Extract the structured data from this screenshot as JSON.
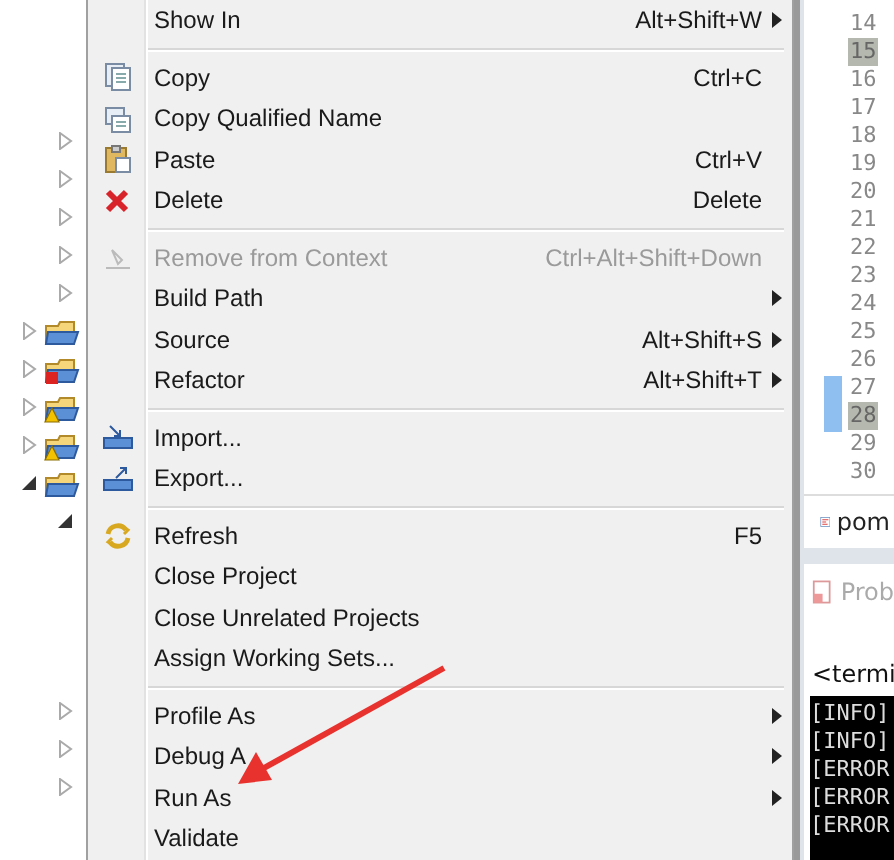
{
  "tree": [
    {
      "kind": "node",
      "expanded": false
    },
    {
      "kind": "node",
      "expanded": false
    },
    {
      "kind": "node",
      "expanded": false
    },
    {
      "kind": "node",
      "expanded": false
    },
    {
      "kind": "node",
      "expanded": false
    },
    {
      "kind": "project",
      "expanded": false
    },
    {
      "kind": "project",
      "expanded": false
    },
    {
      "kind": "project",
      "expanded": false
    },
    {
      "kind": "project",
      "expanded": false
    },
    {
      "kind": "project",
      "expanded": true
    },
    {
      "kind": "node",
      "expanded": true
    },
    {
      "kind": "node",
      "expanded": false
    },
    {
      "kind": "node",
      "expanded": false
    },
    {
      "kind": "node",
      "expanded": false
    }
  ],
  "menu": [
    {
      "kind": "item",
      "label": "Show In",
      "shortcut": "Alt+Shift+W",
      "submenu": true,
      "disabled": false
    },
    {
      "kind": "separator"
    },
    {
      "kind": "item",
      "label": "Copy",
      "shortcut": "Ctrl+C",
      "submenu": false,
      "disabled": false
    },
    {
      "kind": "item",
      "label": "Copy Qualified Name",
      "submenu": false,
      "disabled": false
    },
    {
      "kind": "item",
      "label": "Paste",
      "shortcut": "Ctrl+V",
      "submenu": false,
      "disabled": false
    },
    {
      "kind": "item",
      "label": "Delete",
      "shortcut": "Delete",
      "submenu": false,
      "disabled": false
    },
    {
      "kind": "separator"
    },
    {
      "kind": "item",
      "label": "Remove from Context",
      "shortcut": "Ctrl+Alt+Shift+Down",
      "submenu": false,
      "disabled": true
    },
    {
      "kind": "item",
      "label": "Build Path",
      "submenu": true,
      "disabled": false
    },
    {
      "kind": "item",
      "label": "Source",
      "shortcut": "Alt+Shift+S",
      "submenu": true,
      "disabled": false
    },
    {
      "kind": "item",
      "label": "Refactor",
      "shortcut": "Alt+Shift+T",
      "submenu": true,
      "disabled": false
    },
    {
      "kind": "separator"
    },
    {
      "kind": "item",
      "label": "Import...",
      "submenu": false,
      "disabled": false
    },
    {
      "kind": "item",
      "label": "Export...",
      "submenu": false,
      "disabled": false
    },
    {
      "kind": "separator"
    },
    {
      "kind": "item",
      "label": "Refresh",
      "shortcut": "F5",
      "submenu": false,
      "disabled": false
    },
    {
      "kind": "item",
      "label": "Close Project",
      "submenu": false,
      "disabled": false
    },
    {
      "kind": "item",
      "label": "Close Unrelated Projects",
      "submenu": false,
      "disabled": false
    },
    {
      "kind": "item",
      "label": "Assign Working Sets...",
      "submenu": false,
      "disabled": false
    },
    {
      "kind": "separator"
    },
    {
      "kind": "item",
      "label": "Profile As",
      "submenu": true,
      "disabled": false
    },
    {
      "kind": "item",
      "label": "Debug A",
      "submenu": true,
      "disabled": false
    },
    {
      "kind": "item",
      "label": "Run As",
      "submenu": true,
      "disabled": false
    },
    {
      "kind": "item",
      "label": "Validate",
      "submenu": false,
      "disabled": false
    }
  ],
  "editor": {
    "line_numbers": [
      {
        "text": "14",
        "selected": false
      },
      {
        "text": "15",
        "selected": true
      },
      {
        "text": "16",
        "selected": false
      },
      {
        "text": "17",
        "selected": false
      },
      {
        "text": "18",
        "selected": false
      },
      {
        "text": "19",
        "selected": false
      },
      {
        "text": "20",
        "selected": false
      },
      {
        "text": "21",
        "selected": false
      },
      {
        "text": "22",
        "selected": false
      },
      {
        "text": "23",
        "selected": false
      },
      {
        "text": "24",
        "selected": false
      },
      {
        "text": "25",
        "selected": false
      },
      {
        "text": "26",
        "selected": false
      },
      {
        "text": "27",
        "selected": false
      },
      {
        "text": "28",
        "selected": true
      },
      {
        "text": "29",
        "selected": false
      },
      {
        "text": "30",
        "selected": false
      }
    ],
    "tab": "pom"
  },
  "bottom_panel": {
    "tab": "Prob",
    "console_title": "<termi",
    "console_lines": [
      "[INFO]",
      "[INFO]",
      "[ERROR",
      "[ERROR",
      "[ERROR"
    ]
  }
}
